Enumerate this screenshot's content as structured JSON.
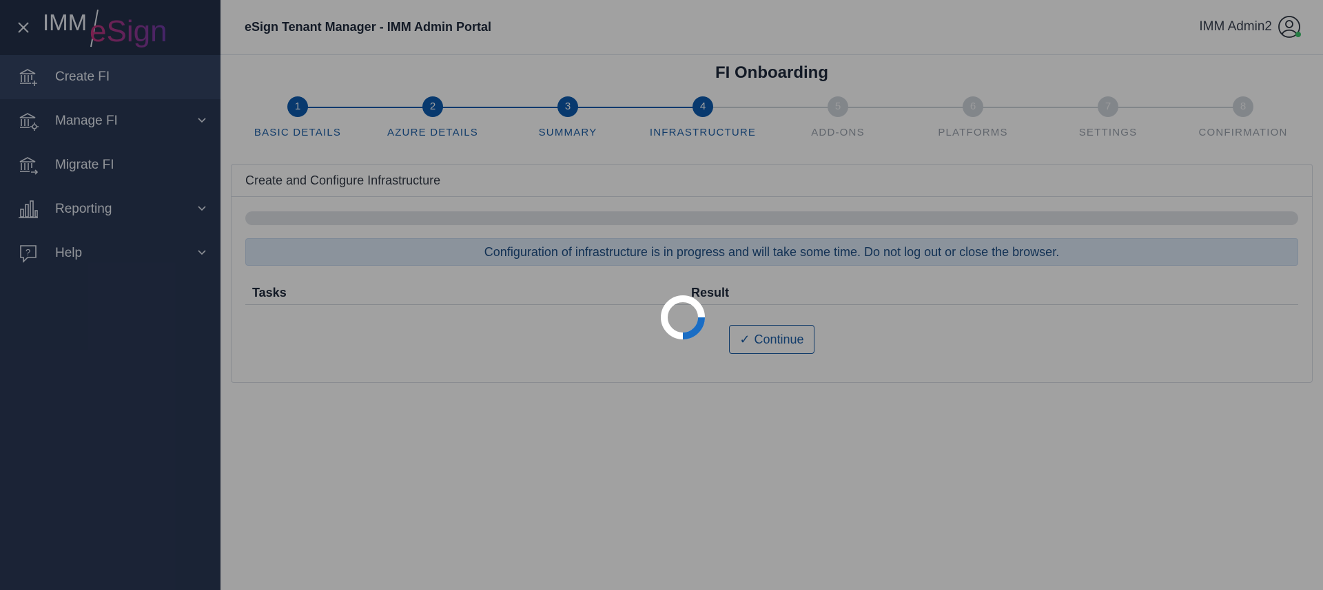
{
  "sidebar": {
    "logo": {
      "part1": "IMM",
      "part2": "eSign"
    },
    "items": [
      {
        "label": "Create FI",
        "icon": "bank-plus-icon"
      },
      {
        "label": "Manage FI",
        "icon": "bank-gear-icon"
      },
      {
        "label": "Migrate FI",
        "icon": "bank-arrow-icon"
      },
      {
        "label": "Reporting",
        "icon": "bar-chart-icon"
      },
      {
        "label": "Help",
        "icon": "help-chat-icon"
      }
    ]
  },
  "header": {
    "app_title": "eSign Tenant Manager - IMM Admin Portal",
    "user_name": "IMM Admin2"
  },
  "page": {
    "title": "FI Onboarding"
  },
  "stepper": {
    "steps": [
      {
        "number": "1",
        "label": "BASIC DETAILS",
        "state": "done"
      },
      {
        "number": "2",
        "label": "AZURE DETAILS",
        "state": "done"
      },
      {
        "number": "3",
        "label": "SUMMARY",
        "state": "done"
      },
      {
        "number": "4",
        "label": "INFRASTRUCTURE",
        "state": "done"
      },
      {
        "number": "5",
        "label": "ADD-ONS",
        "state": "todo"
      },
      {
        "number": "6",
        "label": "PLATFORMS",
        "state": "todo"
      },
      {
        "number": "7",
        "label": "SETTINGS",
        "state": "todo"
      },
      {
        "number": "8",
        "label": "CONFIRMATION",
        "state": "todo"
      }
    ]
  },
  "card": {
    "title": "Create and Configure Infrastructure",
    "progress": 0,
    "alert": "Configuration of infrastructure is in progress and will take some time. Do not log out or close the browser.",
    "table_headers": {
      "tasks": "Tasks",
      "result": "Result"
    },
    "continue_label": "Continue"
  },
  "colors": {
    "sidebar_bg": "#2a3855",
    "accent": "#0d5bae",
    "step_inactive": "#cfd4db",
    "alert_bg": "#dde9f7",
    "logo_pink": "#c2347a",
    "logo_purple": "#6b3ba6"
  }
}
